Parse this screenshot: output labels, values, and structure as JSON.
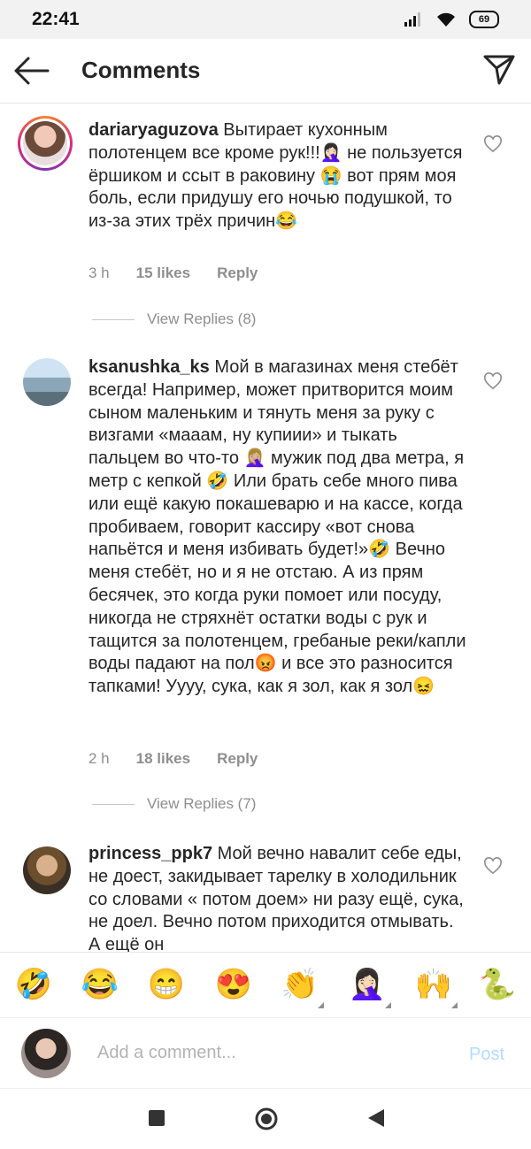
{
  "status": {
    "time": "22:41",
    "battery": "69"
  },
  "header": {
    "title": "Comments"
  },
  "comments": [
    {
      "username": "dariaryaguzova",
      "text": "Вытирает кухонным полотенцем все кроме рук!!!🤦🏻‍♀️ не пользуется ёршиком и ссыт в раковину 😭 вот прям моя боль, если придушу его ночью подушкой, то из-за этих трёх причин😂",
      "time": "3 h",
      "likes": "15 likes",
      "reply": "Reply",
      "view_replies": "View Replies (8)"
    },
    {
      "username": "ksanushka_ks",
      "text": "Мой в магазинах меня стебёт всегда! Например, может притворится моим сыном маленьким и тянуть меня за руку с визгами «мааам, ну купиии» и тыкать пальцем во что-то 🤦🏼‍♀️ мужик под два метра, я метр с кепкой 🤣 Или брать себе много пива или ещё какую покашеварю и на кассе, когда пробиваем, говорит кассиру «вот снова напьётся и меня избивать будет!»🤣 Вечно меня стебёт, но и я не отстаю. А из прям бесячек, это когда руки помоет или посуду, никогда не стряхнёт остатки воды с рук и тащится за полотенцем, гребаные реки/капли воды падают на пол😡 и все это разносится тапками! Уууу, сука, как я зол, как я зол😖",
      "time": "2 h",
      "likes": "18 likes",
      "reply": "Reply",
      "view_replies": "View Replies (7)"
    },
    {
      "username": "princess_ppk7",
      "text": "Мой вечно навалит себе еды, не доест, закидывает тарелку в холодильник со словами « потом доем» ни разу ещё, сука, не доел. Вечно потом приходится отмывать. А ещё он"
    }
  ],
  "emoji_bar": [
    "🤣",
    "😂",
    "😁",
    "😍",
    "👏",
    "🤦🏻‍♀️",
    "🙌",
    "🐍"
  ],
  "composer": {
    "placeholder": "Add a comment...",
    "post_label": "Post"
  }
}
